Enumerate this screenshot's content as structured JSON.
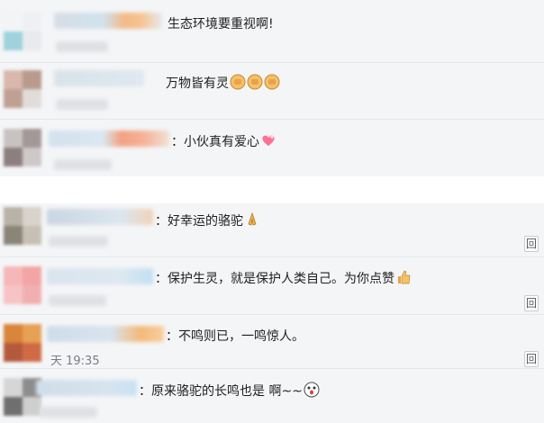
{
  "comments_top": [
    {
      "text": "生态环境要重视啊!"
    },
    {
      "text": "万物皆有灵",
      "icon": "fist-emoji"
    },
    {
      "text": "：小伙真有爱心",
      "icon": "heart-emoji"
    }
  ],
  "comments_bottom": [
    {
      "text": "：好幸运的骆驼",
      "icon": "pray-emoji",
      "reply_label": "回"
    },
    {
      "text": "：保护生灵，就是保护人类自己。为你点赞",
      "icon": "thumbs-up-emoji",
      "reply_label": "回"
    },
    {
      "text": "：不鸣则已，一鸣惊人。",
      "time": "天 19:35",
      "reply_label": "回"
    },
    {
      "text": "：原来骆驼的长鸣也是 啊~~",
      "icon": "surprised-emoji"
    }
  ],
  "colors": {
    "panel_bg": "#f4f5f7",
    "divider": "#e6e7ea",
    "text": "#1e1e1e"
  }
}
